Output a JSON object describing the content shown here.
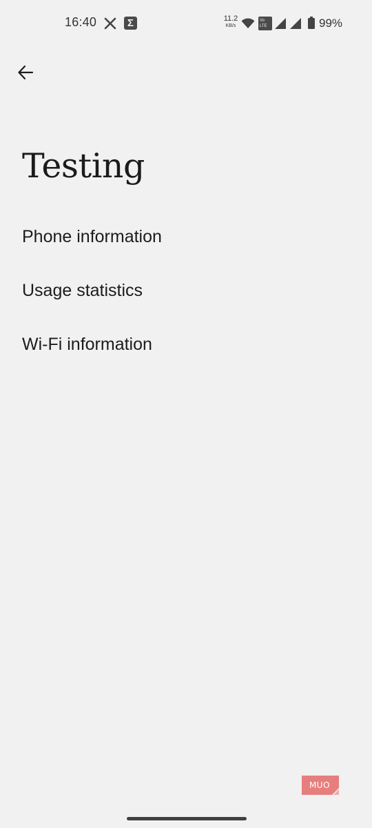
{
  "status_bar": {
    "time": "16:40",
    "net_speed_value": "11.2",
    "net_speed_unit": "KB/s",
    "volte_top": "Vo",
    "volte_bottom": "LTE",
    "battery_percent": "99%",
    "icons": [
      "x-app-icon",
      "sigma-app-icon",
      "wifi-icon",
      "volte-icon",
      "signal-icon",
      "signal-icon",
      "battery-icon"
    ]
  },
  "header": {
    "back_icon": "arrow-left-icon",
    "title": "Testing"
  },
  "menu": {
    "items": [
      {
        "label": "Phone information"
      },
      {
        "label": "Usage statistics"
      },
      {
        "label": "Wi-Fi information"
      }
    ]
  },
  "watermark": {
    "text": "MUO",
    "color": "#e56a6a"
  },
  "colors": {
    "background": "#f1f1f1",
    "text": "#1b1b1b"
  }
}
